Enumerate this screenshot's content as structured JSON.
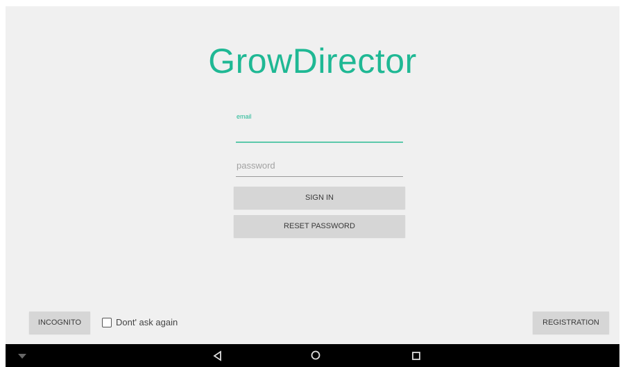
{
  "app": {
    "title": "GrowDirector"
  },
  "login": {
    "email_label": "email",
    "email_value": "",
    "password_placeholder": "password",
    "sign_in_label": "SIGN IN",
    "reset_password_label": "RESET PASSWORD"
  },
  "footer": {
    "incognito_label": "INCOGNITO",
    "dont_ask_label": "Dont' ask again",
    "dont_ask_checked": false,
    "registration_label": "REGISTRATION"
  },
  "navbar": {
    "icons": [
      "wifi-icon",
      "back-icon",
      "home-icon",
      "recent-apps-icon"
    ]
  },
  "colors": {
    "accent": "#1fb894",
    "background": "#f0f0f0",
    "button": "#d6d6d6",
    "navbar": "#000000"
  }
}
